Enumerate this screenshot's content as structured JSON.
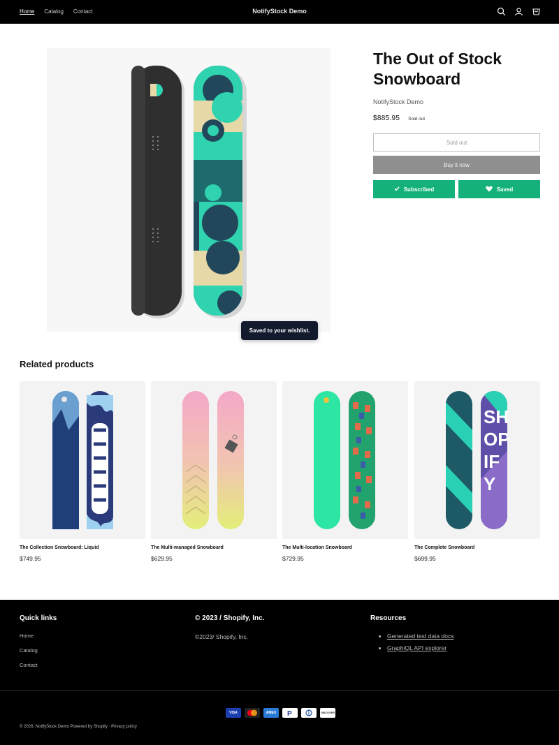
{
  "header": {
    "nav": [
      "Home",
      "Catalog",
      "Contact"
    ],
    "brand": "NotifyStock Demo",
    "icons": [
      "search-icon",
      "account-icon",
      "cart-icon"
    ]
  },
  "product": {
    "title": "The Out of Stock Snowboard",
    "vendor": "NotifyStock Demo",
    "price": "$885.95",
    "badge": "Sold out",
    "sold_out_label": "Sold out",
    "buy_label": "Buy it now",
    "subscribed_label": "Subscribed",
    "saved_label": "Saved"
  },
  "toast": "Saved to your wishlist.",
  "related": {
    "title": "Related products",
    "items": [
      {
        "name": "The Collection Snowboard: Liquid",
        "price": "$749.95"
      },
      {
        "name": "The Multi-managed Snowboard",
        "price": "$629.95"
      },
      {
        "name": "The Multi-location Snowboard",
        "price": "$729.95"
      },
      {
        "name": "The Complete Snowboard",
        "price": "$699.95"
      }
    ]
  },
  "footer": {
    "quick_links_title": "Quick links",
    "quick_links": [
      "Home",
      "Catalog",
      "Contact"
    ],
    "company_title": "© 2023 / Shopify, Inc.",
    "company_text": "©2023/ Shopify, Inc.",
    "resources_title": "Resources",
    "resources": [
      "Generated test data docs",
      "GraphiQL API explorer"
    ],
    "payments": [
      "VISA",
      "MC",
      "AMEX",
      "PayPal",
      "Diners",
      "DISCOVER"
    ],
    "copyright": "© 2026, NotifyStock Demo Powered by Shopify  ·  Privacy policy"
  },
  "colors": {
    "accent_green": "#14b27a",
    "header_bg": "#000000",
    "toast_bg": "#141a2e"
  }
}
